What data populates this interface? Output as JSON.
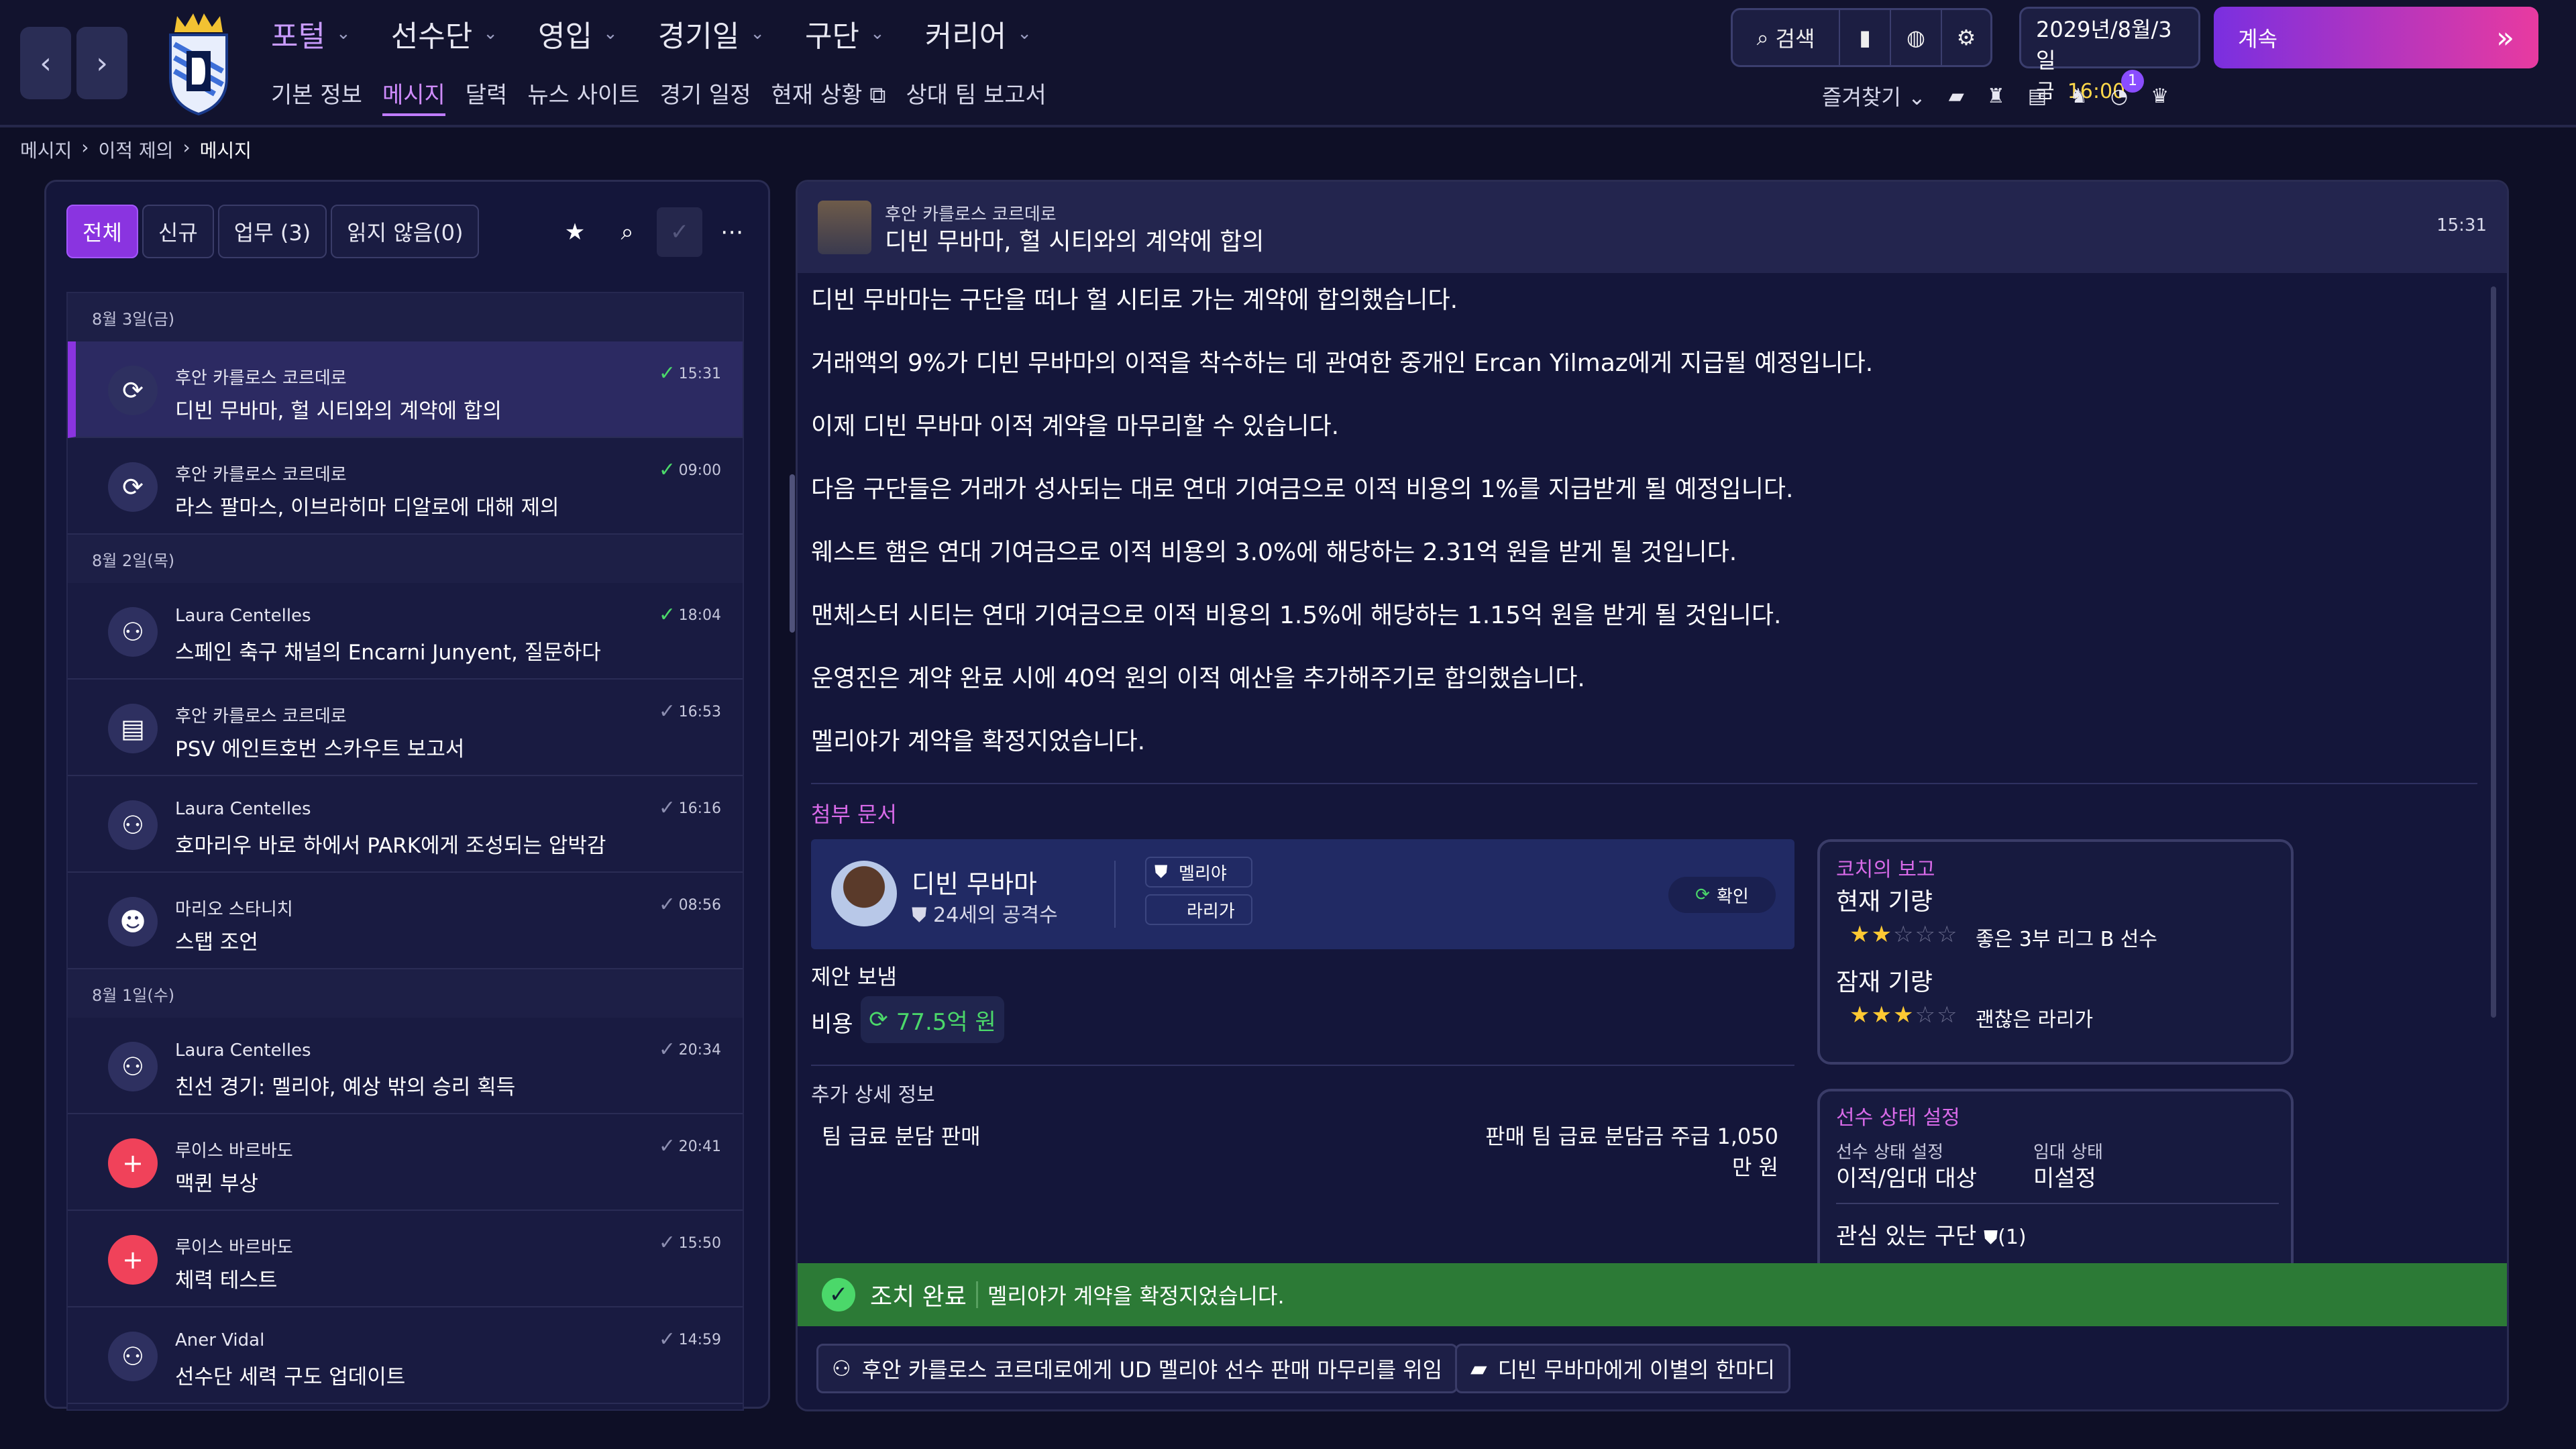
{
  "nav": {
    "main": [
      {
        "label": "포털",
        "active": true
      },
      {
        "label": "선수단"
      },
      {
        "label": "영입"
      },
      {
        "label": "경기일"
      },
      {
        "label": "구단"
      },
      {
        "label": "커리어"
      }
    ],
    "sub": [
      {
        "label": "기본 정보"
      },
      {
        "label": "메시지",
        "active": true
      },
      {
        "label": "달력"
      },
      {
        "label": "뉴스 사이트"
      },
      {
        "label": "경기 일정"
      },
      {
        "label": "현재 상황"
      },
      {
        "label": "상대 팀 보고서"
      }
    ]
  },
  "toolbar": {
    "search_label": "검색"
  },
  "date": {
    "line1": "2029년/8월/3일",
    "weekday": "금",
    "time": "16:00"
  },
  "continue_label": "계속",
  "favorites": {
    "label": "즐겨찾기",
    "badge": "1"
  },
  "breadcrumb": [
    "메시지",
    "이적 제의",
    "메시지"
  ],
  "filters": [
    "전체",
    "신규",
    "업무 (3)",
    "읽지 않음(0)"
  ],
  "messages": [
    {
      "day": "8월 3일(금)"
    },
    {
      "from": "후안 카를로스 코르데로",
      "subject": "디빈 무바마, 헐 시티와의 계약에 합의",
      "time": "15:31",
      "icon": "transfer-icon",
      "selected": true,
      "read": "green"
    },
    {
      "from": "후안 카를로스 코르데로",
      "subject": "라스 팔마스, 이브라히마 디알로에 대해 제의",
      "time": "09:00",
      "icon": "transfer-icon",
      "read": "green"
    },
    {
      "day": "8월 2일(목)"
    },
    {
      "from": "Laura Centelles",
      "subject": "스페인 축구 채널의 Encarni Junyent, 질문하다",
      "time": "18:04",
      "icon": "people-icon",
      "read": "green"
    },
    {
      "from": "후안 카를로스 코르데로",
      "subject": "PSV 에인트호번 스카우트 보고서",
      "time": "16:53",
      "icon": "briefcase-icon",
      "read": "grey"
    },
    {
      "from": "Laura Centelles",
      "subject": "호마리우 바로 하에서 PARK에게 조성되는 압박감",
      "time": "16:16",
      "icon": "people-icon",
      "read": "grey"
    },
    {
      "from": "마리오 스타니치",
      "subject": "스탭 조언",
      "time": "08:56",
      "icon": "staff-icon",
      "read": "grey"
    },
    {
      "day": "8월 1일(수)"
    },
    {
      "from": "Laura Centelles",
      "subject": "친선 경기: 멜리야, 예상 밖의 승리 획득",
      "time": "20:34",
      "icon": "people-icon",
      "read": "grey"
    },
    {
      "from": "루이스 바르바도",
      "subject": "맥퀸 부상",
      "time": "20:41",
      "icon": "medical-icon",
      "read": "grey"
    },
    {
      "from": "루이스 바르바도",
      "subject": "체력 테스트",
      "time": "15:50",
      "icon": "medical-icon",
      "read": "grey"
    },
    {
      "from": "Aner Vidal",
      "subject": "선수단 세력 구도 업데이트",
      "time": "14:59",
      "icon": "people-icon",
      "read": "grey"
    }
  ],
  "detail": {
    "from": "후안 카를로스 코르데로",
    "subject": "디빈 무바마, 헐 시티와의 계약에 합의",
    "time": "15:31",
    "paragraphs": [
      "디빈 무바마는 구단을 떠나 헐 시티로 가는 계약에 합의했습니다.",
      "거래액의 9%가 디빈 무바마의 이적을 착수하는 데 관여한 중개인 Ercan Yilmaz에게 지급될 예정입니다.",
      "이제 디빈 무바마 이적 계약을 마무리할 수 있습니다.",
      "다음 구단들은 거래가 성사되는 대로 연대 기여금으로 이적 비용의 1%를 지급받게 될 예정입니다.",
      "웨스트 햄은 연대 기여금으로 이적 비용의 3.0%에 해당하는 2.31억 원을 받게 될 것입니다.",
      "맨체스터 시티는 연대 기여금으로 이적 비용의 1.5%에 해당하는 1.15억 원을 받게 될 것입니다.",
      "운영진은 계약 완료 시에 40억 원의 이적 예산을 추가해주기로 합의했습니다.",
      "멜리야가 계약을 확정지었습니다."
    ],
    "attachments_label": "첨부 문서",
    "player": {
      "name": "디빈 무바마",
      "desc": "24세의 공격수",
      "club": "멜리야",
      "league": "라리가",
      "confirm": "확인"
    },
    "offer": {
      "title": "제안 보냄",
      "fee_label": "비용",
      "fee_value": "77.5억 원"
    },
    "extra": {
      "title": "추가 상세 정보",
      "left": "팀 급료 분담 판매",
      "right": "판매 팀 급료 분담금 주급 1,050만 원"
    },
    "coach": {
      "title": "코치의 보고",
      "current_label": "현재 기량",
      "current_stars": 2,
      "current_desc": "좋은 3부 리그 B 선수",
      "potential_label": "잠재 기량",
      "potential_stars": 3,
      "potential_desc": "괜찮은 라리가"
    },
    "status": {
      "title": "선수 상태 설정",
      "transfer_label": "선수 상태 설정",
      "transfer_value": "이적/임대 대상",
      "loan_label": "임대 상태",
      "loan_value": "미설정",
      "interested_label": "관심 있는 구단",
      "interested_count": "(1)"
    },
    "done": {
      "label": "조치 완료",
      "message": "멜리야가 계약을 확정지었습니다."
    },
    "actions": [
      "후안 카를로스 코르데로에게 UD 멜리야 선수 판매 마무리를 위임",
      "디빈 무바마에게 이별의 한마디"
    ]
  },
  "colors": {
    "accent": "#8a34e0",
    "success": "#2c7a36",
    "star": "#ffc933"
  }
}
